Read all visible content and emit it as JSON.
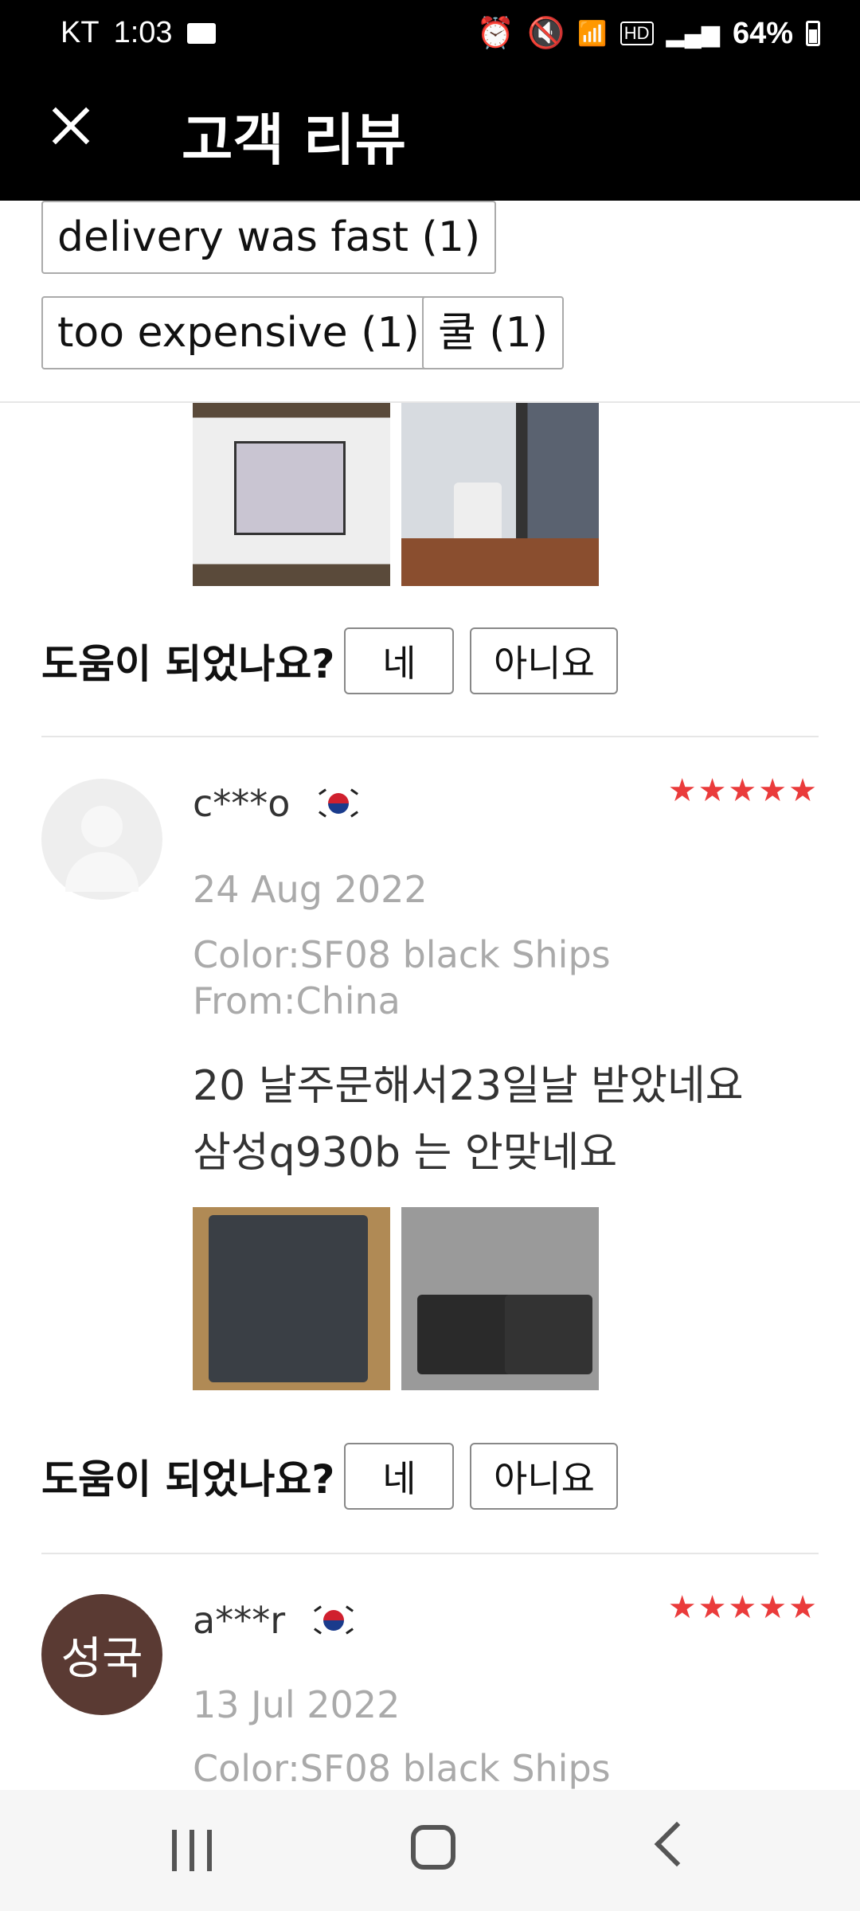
{
  "status_bar": {
    "carrier": "KT",
    "time": "1:03",
    "battery": "64%"
  },
  "header": {
    "title": "고객 리뷰"
  },
  "tags": [
    {
      "label": "delivery was fast (1)"
    },
    {
      "label": "too expensive (1)"
    },
    {
      "label": "쿨 (1)"
    }
  ],
  "helpful": {
    "question": "도움이 되었나요?",
    "yes": "네",
    "no": "아니요"
  },
  "reviews": [
    {
      "avatar_text": "",
      "username": "c***o",
      "flag": "korea-flag-icon",
      "rating": 5,
      "stars": "★★★★★",
      "date": "24 Aug 2022",
      "color_line": "Color:SF08 black Ships",
      "from_line": "From:China",
      "comment_line1": "20 날주문해서23일날 받았네요",
      "comment_line2": "삼성q930b 는 안맞네요"
    },
    {
      "avatar_text": "성국",
      "username": "a***r",
      "flag": "korea-flag-icon",
      "rating": 5,
      "stars": "★★★★★",
      "date": "13 Jul 2022",
      "color_line": "Color:SF08 black Ships"
    }
  ],
  "colors": {
    "header_bg": "#000000",
    "star": "#ea3b3b",
    "avatar_brown": "#5a3a33",
    "meta_gray": "#aaaaaa"
  }
}
